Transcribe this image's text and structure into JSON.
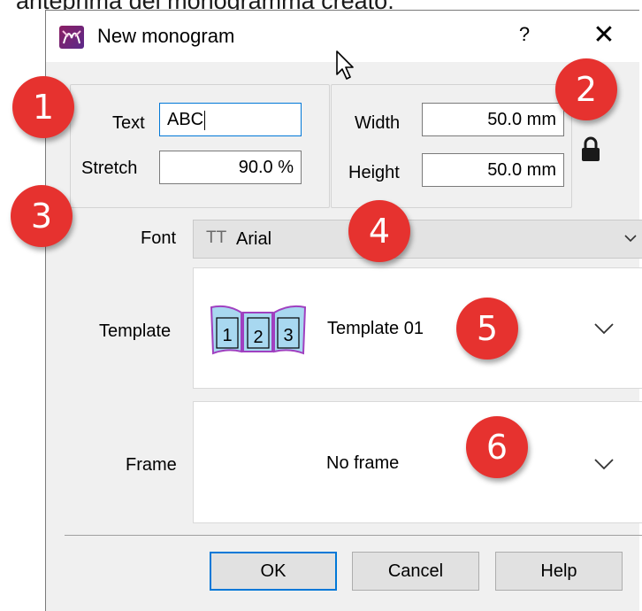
{
  "caption": "anteprima del monogramma creato.",
  "window": {
    "title": "New monogram",
    "help": "?",
    "close": "✕"
  },
  "text_group": {
    "text_label": "Text",
    "text_value": "ABC",
    "stretch_label": "Stretch",
    "stretch_value": "90.0 %"
  },
  "size_group": {
    "width_label": "Width",
    "width_value": "50.0 mm",
    "height_label": "Height",
    "height_value": "50.0 mm",
    "lock_icon": "lock-icon"
  },
  "font": {
    "label": "Font",
    "icon": "TT",
    "value": "Arial"
  },
  "template": {
    "label": "Template",
    "value": "Template 01",
    "preview": [
      "1",
      "2",
      "3"
    ]
  },
  "frame": {
    "label": "Frame",
    "value": "No frame"
  },
  "buttons": {
    "ok": "OK",
    "cancel": "Cancel",
    "help": "Help"
  },
  "markers": [
    "1",
    "2",
    "3",
    "4",
    "5",
    "6"
  ],
  "colors": {
    "accent": "#0078d7",
    "marker": "#e6322f",
    "template_fill": "#a8d8f0",
    "template_outline": "#a040c0"
  }
}
